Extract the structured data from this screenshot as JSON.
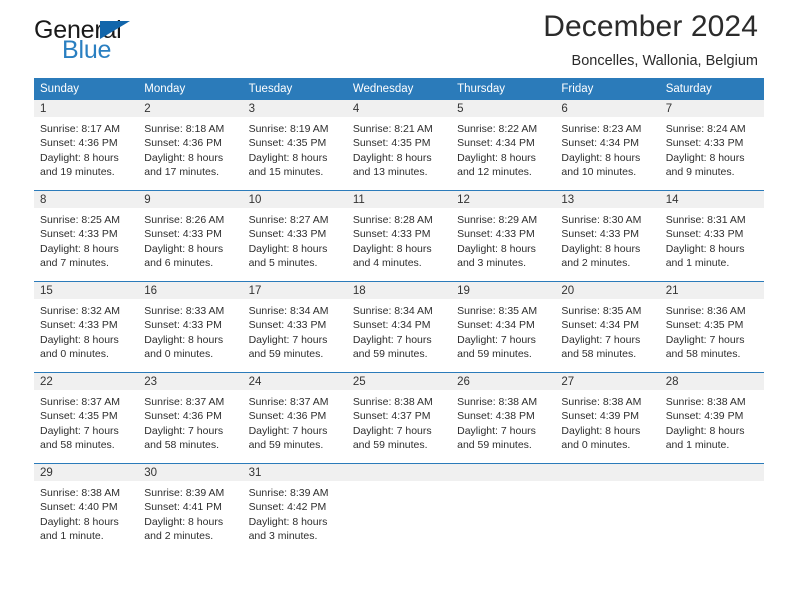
{
  "brand": {
    "name_part1": "General",
    "name_part2": "Blue",
    "triangle_icon": "triangle-icon",
    "accent_color": "#2a7fc1",
    "triangle_color": "#1266ab"
  },
  "header": {
    "month_title": "December 2024",
    "location": "Boncelles, Wallonia, Belgium"
  },
  "calendar": {
    "header_bg": "#2b7bba",
    "day_band_bg": "#f0f0f0",
    "weekdays": [
      "Sunday",
      "Monday",
      "Tuesday",
      "Wednesday",
      "Thursday",
      "Friday",
      "Saturday"
    ],
    "weeks": [
      [
        {
          "day": "1",
          "sunrise": "Sunrise: 8:17 AM",
          "sunset": "Sunset: 4:36 PM",
          "daylight_line1": "Daylight: 8 hours",
          "daylight_line2": "and 19 minutes."
        },
        {
          "day": "2",
          "sunrise": "Sunrise: 8:18 AM",
          "sunset": "Sunset: 4:36 PM",
          "daylight_line1": "Daylight: 8 hours",
          "daylight_line2": "and 17 minutes."
        },
        {
          "day": "3",
          "sunrise": "Sunrise: 8:19 AM",
          "sunset": "Sunset: 4:35 PM",
          "daylight_line1": "Daylight: 8 hours",
          "daylight_line2": "and 15 minutes."
        },
        {
          "day": "4",
          "sunrise": "Sunrise: 8:21 AM",
          "sunset": "Sunset: 4:35 PM",
          "daylight_line1": "Daylight: 8 hours",
          "daylight_line2": "and 13 minutes."
        },
        {
          "day": "5",
          "sunrise": "Sunrise: 8:22 AM",
          "sunset": "Sunset: 4:34 PM",
          "daylight_line1": "Daylight: 8 hours",
          "daylight_line2": "and 12 minutes."
        },
        {
          "day": "6",
          "sunrise": "Sunrise: 8:23 AM",
          "sunset": "Sunset: 4:34 PM",
          "daylight_line1": "Daylight: 8 hours",
          "daylight_line2": "and 10 minutes."
        },
        {
          "day": "7",
          "sunrise": "Sunrise: 8:24 AM",
          "sunset": "Sunset: 4:33 PM",
          "daylight_line1": "Daylight: 8 hours",
          "daylight_line2": "and 9 minutes."
        }
      ],
      [
        {
          "day": "8",
          "sunrise": "Sunrise: 8:25 AM",
          "sunset": "Sunset: 4:33 PM",
          "daylight_line1": "Daylight: 8 hours",
          "daylight_line2": "and 7 minutes."
        },
        {
          "day": "9",
          "sunrise": "Sunrise: 8:26 AM",
          "sunset": "Sunset: 4:33 PM",
          "daylight_line1": "Daylight: 8 hours",
          "daylight_line2": "and 6 minutes."
        },
        {
          "day": "10",
          "sunrise": "Sunrise: 8:27 AM",
          "sunset": "Sunset: 4:33 PM",
          "daylight_line1": "Daylight: 8 hours",
          "daylight_line2": "and 5 minutes."
        },
        {
          "day": "11",
          "sunrise": "Sunrise: 8:28 AM",
          "sunset": "Sunset: 4:33 PM",
          "daylight_line1": "Daylight: 8 hours",
          "daylight_line2": "and 4 minutes."
        },
        {
          "day": "12",
          "sunrise": "Sunrise: 8:29 AM",
          "sunset": "Sunset: 4:33 PM",
          "daylight_line1": "Daylight: 8 hours",
          "daylight_line2": "and 3 minutes."
        },
        {
          "day": "13",
          "sunrise": "Sunrise: 8:30 AM",
          "sunset": "Sunset: 4:33 PM",
          "daylight_line1": "Daylight: 8 hours",
          "daylight_line2": "and 2 minutes."
        },
        {
          "day": "14",
          "sunrise": "Sunrise: 8:31 AM",
          "sunset": "Sunset: 4:33 PM",
          "daylight_line1": "Daylight: 8 hours",
          "daylight_line2": "and 1 minute."
        }
      ],
      [
        {
          "day": "15",
          "sunrise": "Sunrise: 8:32 AM",
          "sunset": "Sunset: 4:33 PM",
          "daylight_line1": "Daylight: 8 hours",
          "daylight_line2": "and 0 minutes."
        },
        {
          "day": "16",
          "sunrise": "Sunrise: 8:33 AM",
          "sunset": "Sunset: 4:33 PM",
          "daylight_line1": "Daylight: 8 hours",
          "daylight_line2": "and 0 minutes."
        },
        {
          "day": "17",
          "sunrise": "Sunrise: 8:34 AM",
          "sunset": "Sunset: 4:33 PM",
          "daylight_line1": "Daylight: 7 hours",
          "daylight_line2": "and 59 minutes."
        },
        {
          "day": "18",
          "sunrise": "Sunrise: 8:34 AM",
          "sunset": "Sunset: 4:34 PM",
          "daylight_line1": "Daylight: 7 hours",
          "daylight_line2": "and 59 minutes."
        },
        {
          "day": "19",
          "sunrise": "Sunrise: 8:35 AM",
          "sunset": "Sunset: 4:34 PM",
          "daylight_line1": "Daylight: 7 hours",
          "daylight_line2": "and 59 minutes."
        },
        {
          "day": "20",
          "sunrise": "Sunrise: 8:35 AM",
          "sunset": "Sunset: 4:34 PM",
          "daylight_line1": "Daylight: 7 hours",
          "daylight_line2": "and 58 minutes."
        },
        {
          "day": "21",
          "sunrise": "Sunrise: 8:36 AM",
          "sunset": "Sunset: 4:35 PM",
          "daylight_line1": "Daylight: 7 hours",
          "daylight_line2": "and 58 minutes."
        }
      ],
      [
        {
          "day": "22",
          "sunrise": "Sunrise: 8:37 AM",
          "sunset": "Sunset: 4:35 PM",
          "daylight_line1": "Daylight: 7 hours",
          "daylight_line2": "and 58 minutes."
        },
        {
          "day": "23",
          "sunrise": "Sunrise: 8:37 AM",
          "sunset": "Sunset: 4:36 PM",
          "daylight_line1": "Daylight: 7 hours",
          "daylight_line2": "and 58 minutes."
        },
        {
          "day": "24",
          "sunrise": "Sunrise: 8:37 AM",
          "sunset": "Sunset: 4:36 PM",
          "daylight_line1": "Daylight: 7 hours",
          "daylight_line2": "and 59 minutes."
        },
        {
          "day": "25",
          "sunrise": "Sunrise: 8:38 AM",
          "sunset": "Sunset: 4:37 PM",
          "daylight_line1": "Daylight: 7 hours",
          "daylight_line2": "and 59 minutes."
        },
        {
          "day": "26",
          "sunrise": "Sunrise: 8:38 AM",
          "sunset": "Sunset: 4:38 PM",
          "daylight_line1": "Daylight: 7 hours",
          "daylight_line2": "and 59 minutes."
        },
        {
          "day": "27",
          "sunrise": "Sunrise: 8:38 AM",
          "sunset": "Sunset: 4:39 PM",
          "daylight_line1": "Daylight: 8 hours",
          "daylight_line2": "and 0 minutes."
        },
        {
          "day": "28",
          "sunrise": "Sunrise: 8:38 AM",
          "sunset": "Sunset: 4:39 PM",
          "daylight_line1": "Daylight: 8 hours",
          "daylight_line2": "and 1 minute."
        }
      ],
      [
        {
          "day": "29",
          "sunrise": "Sunrise: 8:38 AM",
          "sunset": "Sunset: 4:40 PM",
          "daylight_line1": "Daylight: 8 hours",
          "daylight_line2": "and 1 minute."
        },
        {
          "day": "30",
          "sunrise": "Sunrise: 8:39 AM",
          "sunset": "Sunset: 4:41 PM",
          "daylight_line1": "Daylight: 8 hours",
          "daylight_line2": "and 2 minutes."
        },
        {
          "day": "31",
          "sunrise": "Sunrise: 8:39 AM",
          "sunset": "Sunset: 4:42 PM",
          "daylight_line1": "Daylight: 8 hours",
          "daylight_line2": "and 3 minutes."
        },
        {
          "day": "",
          "sunrise": "",
          "sunset": "",
          "daylight_line1": "",
          "daylight_line2": ""
        },
        {
          "day": "",
          "sunrise": "",
          "sunset": "",
          "daylight_line1": "",
          "daylight_line2": ""
        },
        {
          "day": "",
          "sunrise": "",
          "sunset": "",
          "daylight_line1": "",
          "daylight_line2": ""
        },
        {
          "day": "",
          "sunrise": "",
          "sunset": "",
          "daylight_line1": "",
          "daylight_line2": ""
        }
      ]
    ]
  }
}
